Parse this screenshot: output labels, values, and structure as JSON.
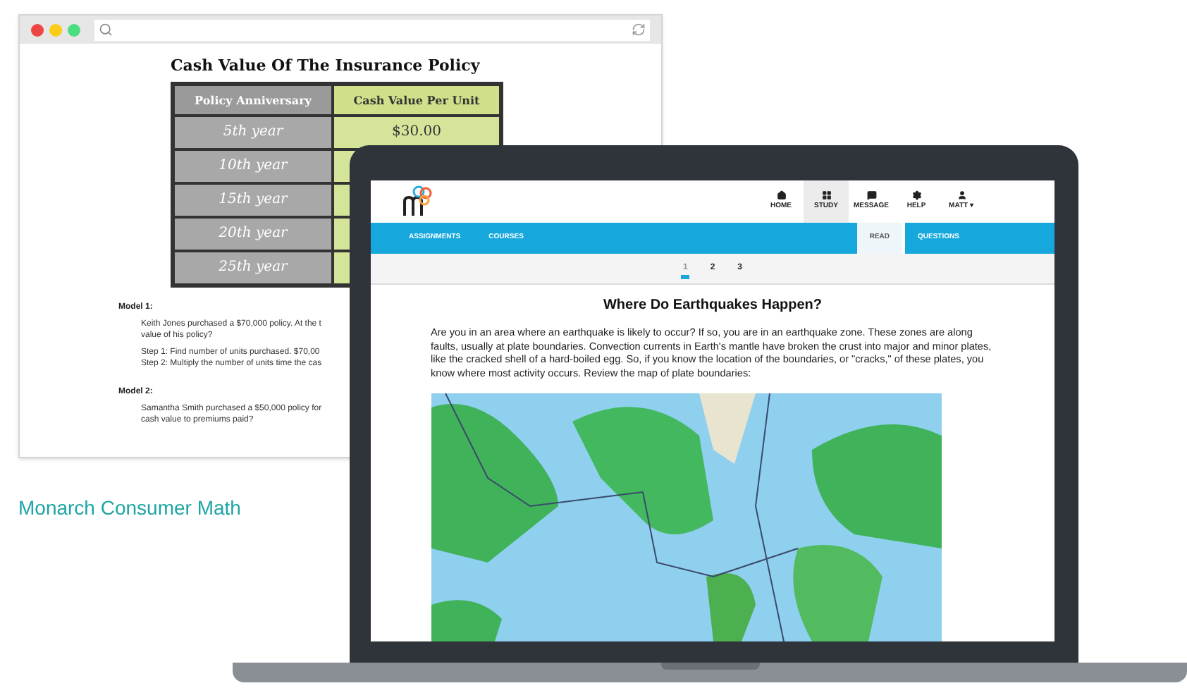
{
  "browser": {
    "document": {
      "title": "Cash Value Of The Insurance Policy",
      "table": {
        "columns": [
          "Policy Anniversary",
          "Cash Value Per Unit"
        ],
        "rows": [
          {
            "year": "5th year",
            "value": "$30.00"
          },
          {
            "year": "10th year"
          },
          {
            "year": "15th year"
          },
          {
            "year": "20th year"
          },
          {
            "year": "25th year"
          }
        ]
      },
      "models": [
        {
          "heading": "Model 1:",
          "lines": [
            "Keith Jones purchased a $70,000 policy. At the t",
            "value of his policy?"
          ],
          "steps": [
            "Step 1: Find number of units purchased. $70,00",
            "Step 2: Multiply the number of units time the cas"
          ]
        },
        {
          "heading": "Model 2:",
          "lines": [
            "Samantha Smith purchased a $50,000 policy for",
            "cash value to premiums paid?"
          ]
        }
      ]
    }
  },
  "caption": "Monarch Consumer Math",
  "laptop": {
    "nav": [
      {
        "label": "HOME",
        "selected": false
      },
      {
        "label": "STUDY",
        "selected": true
      },
      {
        "label": "MESSAGE",
        "selected": false
      },
      {
        "label": "HELP",
        "selected": false
      },
      {
        "label": "MATT ▾",
        "selected": false
      }
    ],
    "menu": [
      "ASSIGNMENTS",
      "COURSES"
    ],
    "tabs": [
      {
        "label": "READ",
        "selected": true
      },
      {
        "label": "QUESTIONS",
        "selected": false
      }
    ],
    "pages": [
      {
        "label": "1",
        "selected": true
      },
      {
        "label": "2",
        "selected": false
      },
      {
        "label": "3",
        "selected": false
      }
    ],
    "article": {
      "title": "Where Do Earthquakes Happen?",
      "text": "Are you in an area where an earthquake is likely to occur? If so, you are in an earthquake zone. These zones are along faults, usually at plate boundaries. Convection currents in Earth's mantle have broken the crust into major and minor plates, like the cracked shell of a hard-boiled egg. So, if you know the location of the boundaries, or \"cracks,\" of these plates, you know where most activity occurs. Review the map of plate boundaries:"
    }
  }
}
